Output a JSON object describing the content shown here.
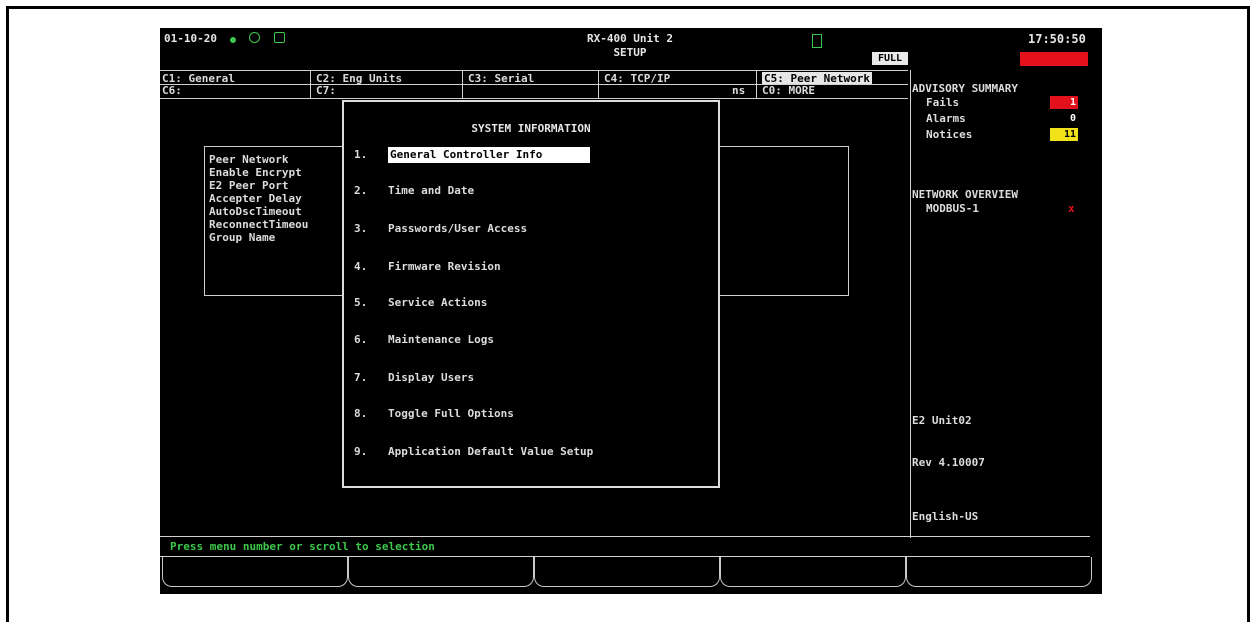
{
  "header": {
    "date": "01-10-20",
    "controller_name": "RX-400 Unit 2",
    "screen": "SETUP",
    "mode": "FULL",
    "time": "17:50:50"
  },
  "tabs_row1": [
    "C1: General",
    "C2: Eng Units",
    "C3: Serial",
    "C4: TCP/IP",
    "C5: Peer Network"
  ],
  "tabs_row2": [
    "C6:",
    "C7:",
    "ns",
    "C0: MORE"
  ],
  "background_panel": {
    "rows": [
      "Peer Network",
      "Enable Encrypt",
      "E2 Peer Port",
      "Accepter Delay",
      "AutoDscTimeout",
      "ReconnectTimeou",
      "Group Name"
    ]
  },
  "dialog": {
    "title": "SYSTEM INFORMATION",
    "items": [
      {
        "num": "1.",
        "label": "General Controller Info"
      },
      {
        "num": "2.",
        "label": "Time and Date"
      },
      {
        "num": "3.",
        "label": "Passwords/User Access"
      },
      {
        "num": "4.",
        "label": "Firmware Revision"
      },
      {
        "num": "5.",
        "label": "Service Actions"
      },
      {
        "num": "6.",
        "label": "Maintenance Logs"
      },
      {
        "num": "7.",
        "label": "Display Users"
      },
      {
        "num": "8.",
        "label": "Toggle Full Options"
      },
      {
        "num": "9.",
        "label": "Application Default Value Setup"
      }
    ],
    "selected_index": 0
  },
  "advisory": {
    "title": "ADVISORY SUMMARY",
    "fails_label": "Fails",
    "fails_count": "1",
    "alarms_label": "Alarms",
    "alarms_count": "0",
    "notices_label": "Notices",
    "notices_count": "11",
    "fails_color": "#e3111b",
    "notices_color": "#f2e21a"
  },
  "network": {
    "title": "NETWORK OVERVIEW",
    "device": "MODBUS-1",
    "status_mark": "x",
    "status_color": "#e3111b"
  },
  "unit_info": {
    "unit": "E2 Unit02",
    "rev": "Rev 4.10007",
    "language": "English-US"
  },
  "status_line": "Press menu number or scroll to selection",
  "colors": {
    "screen_bg": "#000000",
    "text": "#dcdcdc",
    "status_text": "#3cc84a",
    "alert_red": "#e3111b"
  }
}
